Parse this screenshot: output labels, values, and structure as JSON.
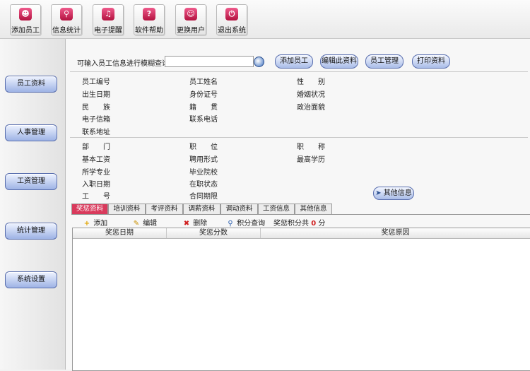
{
  "toolbar": {
    "buttons": [
      {
        "label": "添加员工",
        "icon": "user-add-icon"
      },
      {
        "label": "信息统计",
        "icon": "search-icon"
      },
      {
        "label": "电子提醒",
        "icon": "speaker-icon"
      },
      {
        "label": "软件帮助",
        "icon": "help-icon"
      },
      {
        "label": "更换用户",
        "icon": "switch-user-icon"
      },
      {
        "label": "退出系统",
        "icon": "exit-icon"
      }
    ]
  },
  "sidebar": {
    "items": [
      "员工资料",
      "人事管理",
      "工资管理",
      "统计管理",
      "系统设置"
    ]
  },
  "search": {
    "prompt": "可输入员工信息进行模糊查询",
    "value": ""
  },
  "top_buttons": [
    "添加员工",
    "编辑此资料",
    "员工管理",
    "打印资料"
  ],
  "personal_fields": {
    "col1": [
      "员工编号",
      "出生日期",
      "民　　族",
      "电子信箱",
      "联系地址"
    ],
    "col2": [
      "员工姓名",
      "身份证号",
      "籍　　贯",
      "联系电话"
    ],
    "col3": [
      "性　　别",
      "婚姻状况",
      "政治面貌"
    ]
  },
  "job_fields": {
    "col1": [
      "部　　门",
      "基本工资",
      "所学专业",
      "入职日期",
      "工　　号"
    ],
    "col2": [
      "职　　位",
      "聘用形式",
      "毕业院校",
      "在职状态",
      "合同期限"
    ],
    "col3": [
      "职　　称",
      "最高学历"
    ]
  },
  "other_info_label": "其他信息",
  "tabs": [
    "奖惩资料",
    "培训资料",
    "考评资料",
    "调薪资料",
    "调动资料",
    "工资信息",
    "其他信息"
  ],
  "active_tab": 0,
  "actions": {
    "add": "添加",
    "edit": "编辑",
    "delete": "删除",
    "points_query": "积分查询",
    "total_label": "奖惩积分共",
    "total_value": "0",
    "total_unit": "分"
  },
  "grid": {
    "columns": [
      "奖惩日期",
      "奖惩分数",
      "奖惩原因"
    ]
  },
  "colors": {
    "accent_pink": "#d93a5c",
    "button_blue": "#a9bce8"
  }
}
